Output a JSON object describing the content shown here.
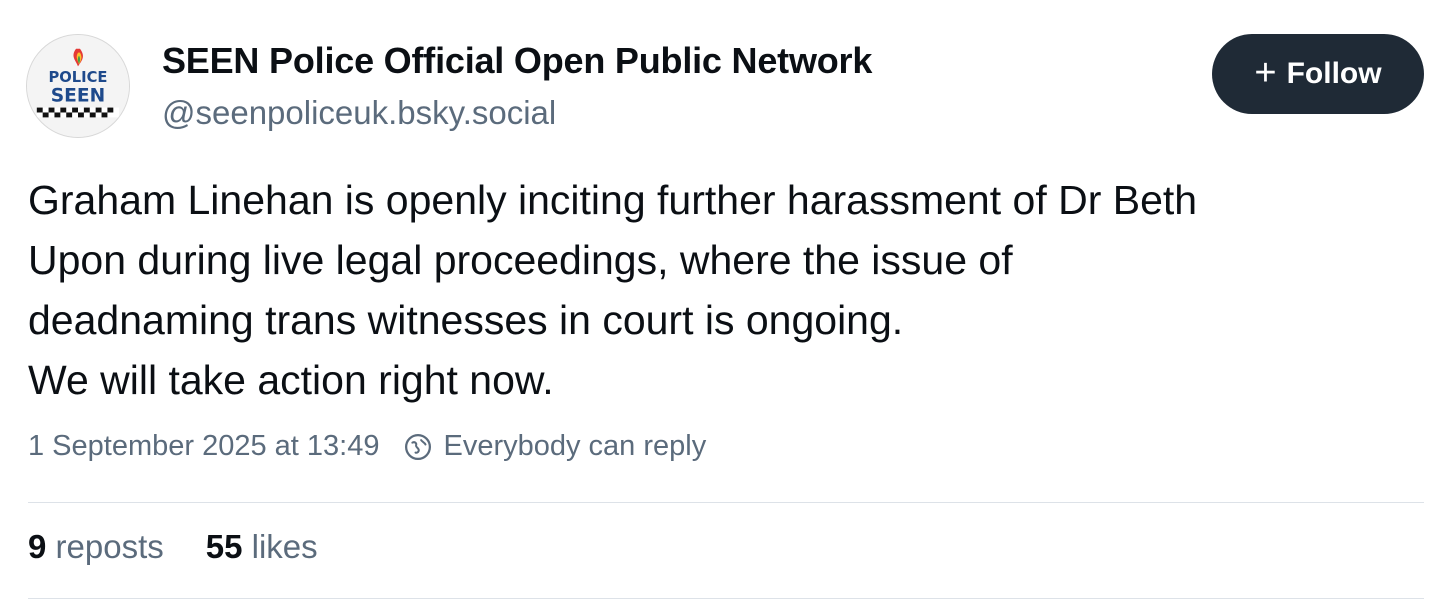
{
  "author": {
    "display_name": "SEEN Police Official Open Public Network",
    "handle": "@seenpoliceuk.bsky.social",
    "avatar": {
      "icon": "police-seen-logo",
      "logo_text_top": "POLICE",
      "logo_text_bottom": "SEEN"
    }
  },
  "follow_button": {
    "icon": "plus-icon",
    "plus_glyph": "+",
    "label": "Follow"
  },
  "post": {
    "lines": [
      "Graham Linehan is openly inciting further harassment of Dr Beth",
      "Upon during live legal proceedings, where the issue of",
      "deadnaming trans witnesses in court is ongoing.",
      "We will take action right now."
    ],
    "timestamp": "1 September 2025 at 13:49",
    "reply_setting": "Everybody can reply",
    "reply_icon": "globe-icon"
  },
  "stats": {
    "reposts_count": "9",
    "reposts_label": "reposts",
    "likes_count": "55",
    "likes_label": "likes"
  },
  "colors": {
    "follow_bg": "#1f2a36",
    "muted_text": "#5b6b7c",
    "primary_text": "#0b0f14",
    "divider": "#dde2e8"
  }
}
